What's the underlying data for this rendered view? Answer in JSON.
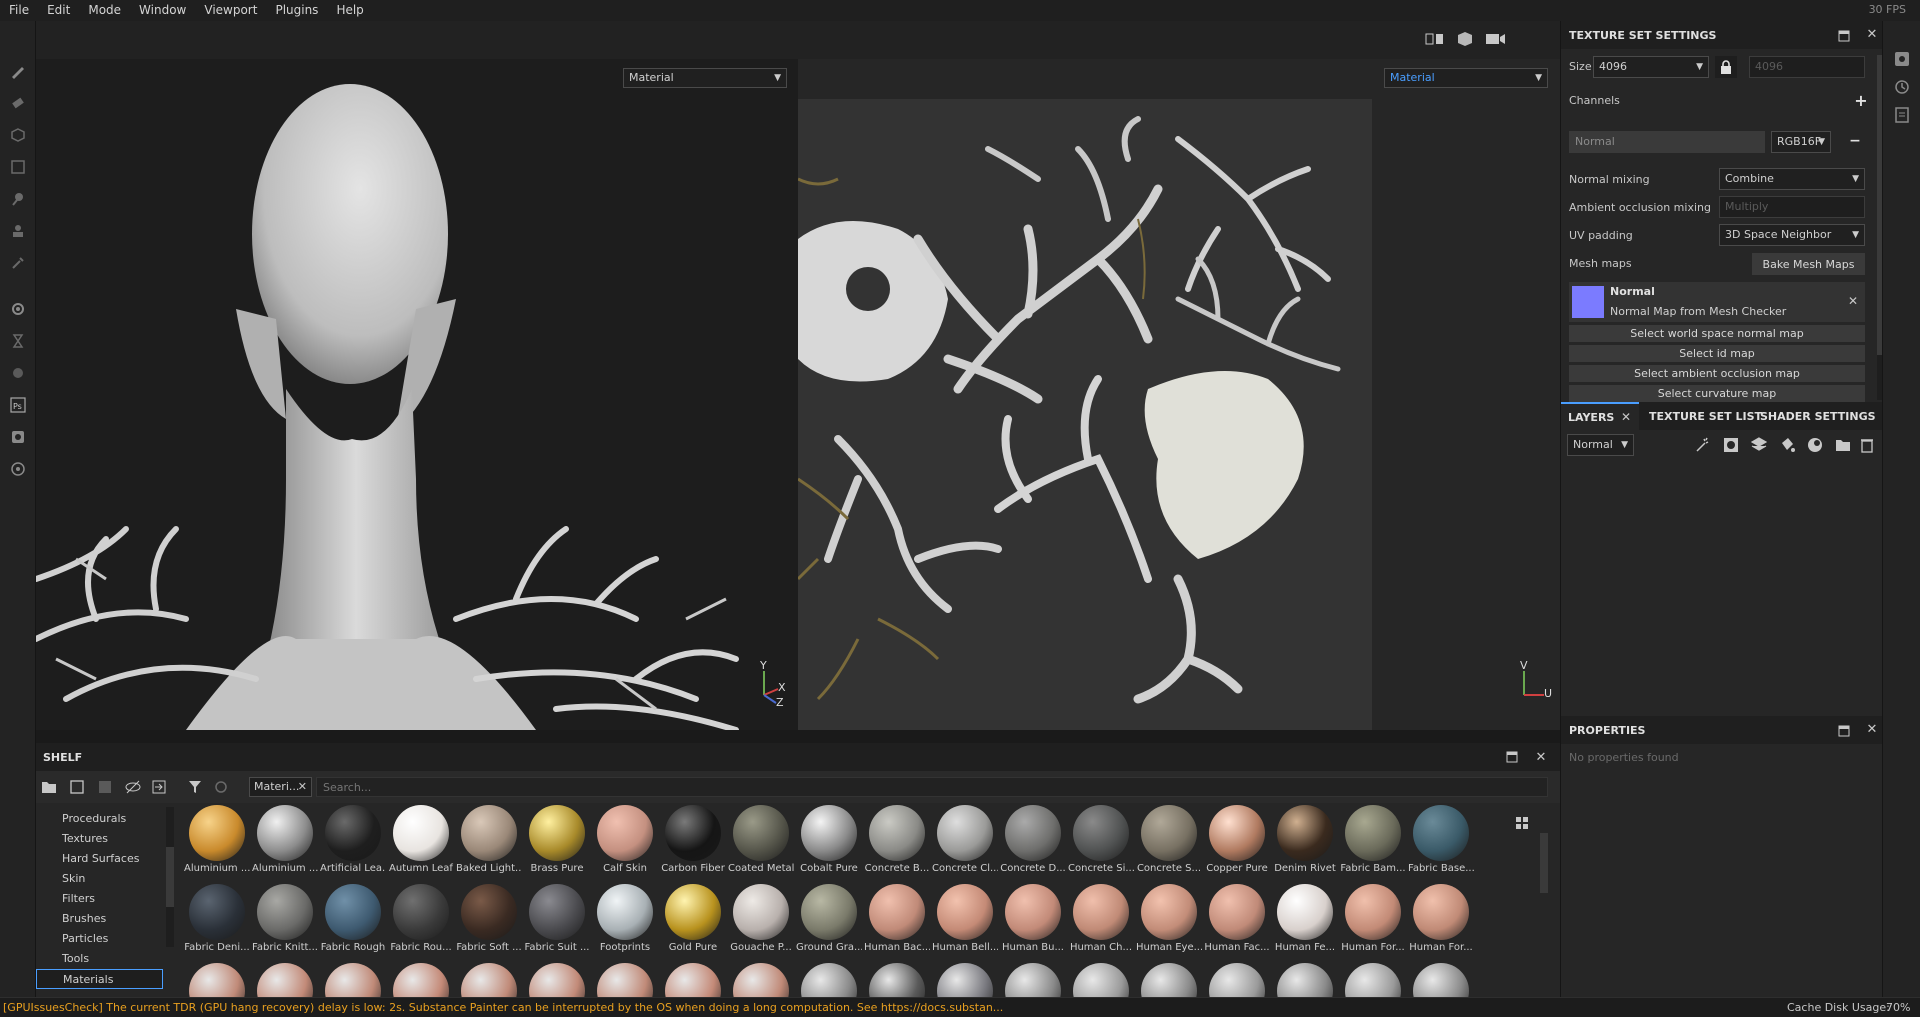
{
  "menu": [
    "File",
    "Edit",
    "Mode",
    "Window",
    "Viewport",
    "Plugins",
    "Help"
  ],
  "fps": "30 FPS",
  "viewport": {
    "left_channel": "Material",
    "right_channel": "Material",
    "axis_3d": {
      "y": "Y",
      "x": "X",
      "z": "Z"
    },
    "axis_2d": {
      "v": "V",
      "u": "U"
    }
  },
  "texture_set_settings": {
    "title": "TEXTURE SET SETTINGS",
    "size_label": "Size",
    "size_value": "4096",
    "size_linked": "4096",
    "channels_label": "Channels",
    "channel_name": "Normal",
    "channel_format": "RGB16F",
    "normal_mixing_label": "Normal mixing",
    "normal_mixing_value": "Combine",
    "ao_mixing_label": "Ambient occlusion mixing",
    "ao_mixing_value": "Multiply",
    "uv_padding_label": "UV padding",
    "uv_padding_value": "3D Space Neighbor",
    "mesh_maps_label": "Mesh maps",
    "bake_button": "Bake Mesh Maps",
    "mesh_map_title": "Normal",
    "mesh_map_sub": "Normal Map from Mesh Checker",
    "mesh_map_color": "#7b7bff",
    "select_buttons": [
      "Select world space normal map",
      "Select id map",
      "Select ambient occlusion map",
      "Select curvature map"
    ]
  },
  "layers": {
    "tabs": [
      "LAYERS",
      "TEXTURE SET LIST",
      "SHADER SETTINGS"
    ],
    "blend_mode": "Normal"
  },
  "properties": {
    "title": "PROPERTIES",
    "empty": "No properties found"
  },
  "shelf": {
    "title": "SHELF",
    "filter_chip": "Materi...",
    "search_placeholder": "Search...",
    "categories": [
      "Procedurals",
      "Textures",
      "Hard Surfaces",
      "Skin",
      "Filters",
      "Brushes",
      "Particles",
      "Tools",
      "Materials"
    ],
    "selected_category": "Materials",
    "row1": [
      {
        "label": "Aluminium ...",
        "color": "#c98a2c",
        "shine": "#f7d38a"
      },
      {
        "label": "Aluminium ...",
        "color": "#8d8d8d",
        "shine": "#f0f0f0"
      },
      {
        "label": "Artificial Lea...",
        "color": "#1e1e1e",
        "shine": "#6a6a6a"
      },
      {
        "label": "Autumn Leaf",
        "color": "#e8e4e0",
        "shine": "#ffffff"
      },
      {
        "label": "Baked Light...",
        "color": "#9a8878",
        "shine": "#d9c8b8"
      },
      {
        "label": "Brass Pure",
        "color": "#a88a2a",
        "shine": "#fff0a0"
      },
      {
        "label": "Calf Skin",
        "color": "#c49080",
        "shine": "#f0c0b0"
      },
      {
        "label": "Carbon Fiber",
        "color": "#151515",
        "shine": "#7a7a7a"
      },
      {
        "label": "Coated Metal",
        "color": "#55554a",
        "shine": "#9a9a88"
      },
      {
        "label": "Cobalt Pure",
        "color": "#8a8a8a",
        "shine": "#f4f4f4"
      },
      {
        "label": "Concrete B...",
        "color": "#8a8a86",
        "shine": "#cacac4"
      },
      {
        "label": "Concrete Cl...",
        "color": "#9a9a98",
        "shine": "#dedede"
      },
      {
        "label": "Concrete D...",
        "color": "#6e6e6c",
        "shine": "#aaaaaa"
      },
      {
        "label": "Concrete Si...",
        "color": "#505252",
        "shine": "#8a8a8a"
      },
      {
        "label": "Concrete S...",
        "color": "#777062",
        "shine": "#b0a898"
      },
      {
        "label": "Copper Pure",
        "color": "#b07a60",
        "shine": "#ffe0d0"
      },
      {
        "label": "Denim Rivet",
        "color": "#3a2a1e",
        "shine": "#d0b090"
      },
      {
        "label": "Fabric Bam...",
        "color": "#6a6a5a",
        "shine": "#a8a890"
      },
      {
        "label": "Fabric Base...",
        "color": "#3a5a68",
        "shine": "#6a8a98"
      }
    ],
    "row2": [
      {
        "label": "Fabric Deni...",
        "color": "#2a3038",
        "shine": "#5a6470"
      },
      {
        "label": "Fabric Knitt...",
        "color": "#6a6a68",
        "shine": "#a8a8a4"
      },
      {
        "label": "Fabric Rough",
        "color": "#3e5a70",
        "shine": "#7090a8"
      },
      {
        "label": "Fabric Rou...",
        "color": "#3a3a3a",
        "shine": "#707070"
      },
      {
        "label": "Fabric Soft ...",
        "color": "#3a2a22",
        "shine": "#7a5a48"
      },
      {
        "label": "Fabric Suit ...",
        "color": "#4a4a4e",
        "shine": "#8a8a90"
      },
      {
        "label": "Footprints",
        "color": "#a8b0b4",
        "shine": "#f0f4f6"
      },
      {
        "label": "Gold Pure",
        "color": "#b8921e",
        "shine": "#fff4b0"
      },
      {
        "label": "Gouache P...",
        "color": "#b8b0ac",
        "shine": "#eeeae6"
      },
      {
        "label": "Ground Gra...",
        "color": "#7a7a6a",
        "shine": "#b8b8a4"
      },
      {
        "label": "Human Bac...",
        "color": "#c08a78",
        "shine": "#f0c0ae"
      },
      {
        "label": "Human Bell...",
        "color": "#c48a76",
        "shine": "#f2c2ae"
      },
      {
        "label": "Human Bu...",
        "color": "#c28a78",
        "shine": "#f0c0ae"
      },
      {
        "label": "Human Ch...",
        "color": "#c08a76",
        "shine": "#f0bfac"
      },
      {
        "label": "Human Eye...",
        "color": "#c28c78",
        "shine": "#f2c2ae"
      },
      {
        "label": "Human Fac...",
        "color": "#c08a78",
        "shine": "#f0c0ae"
      },
      {
        "label": "Human Fe...",
        "color": "#d8d0cc",
        "shine": "#ffffff"
      },
      {
        "label": "Human For...",
        "color": "#c28a76",
        "shine": "#f0c0ac"
      },
      {
        "label": "Human For...",
        "color": "#c08a76",
        "shine": "#f0c0ac"
      }
    ],
    "row3_colors": [
      "#c08a78",
      "#c28a78",
      "#c08a78",
      "#c48a78",
      "#c08a78",
      "#c28a78",
      "#c08a78",
      "#c48a78",
      "#c08a78",
      "#8a8a8a",
      "#5a5a5a",
      "#7a7a80",
      "#8a8a8a",
      "#9a9a9a",
      "#8a8a8a",
      "#9a9a9a",
      "#8a8a8a",
      "#9a9a9a",
      "#8a8a8a"
    ]
  },
  "status": {
    "message": "[GPUIssuesCheck] The current TDR (GPU hang recovery) delay is low: 2s. Substance Painter can be interrupted by the OS when doing a long computation. See https://docs.substan...",
    "cache": "Cache Disk Usage:",
    "cache_value": "70%",
    "warning_color": "#e8a020"
  }
}
